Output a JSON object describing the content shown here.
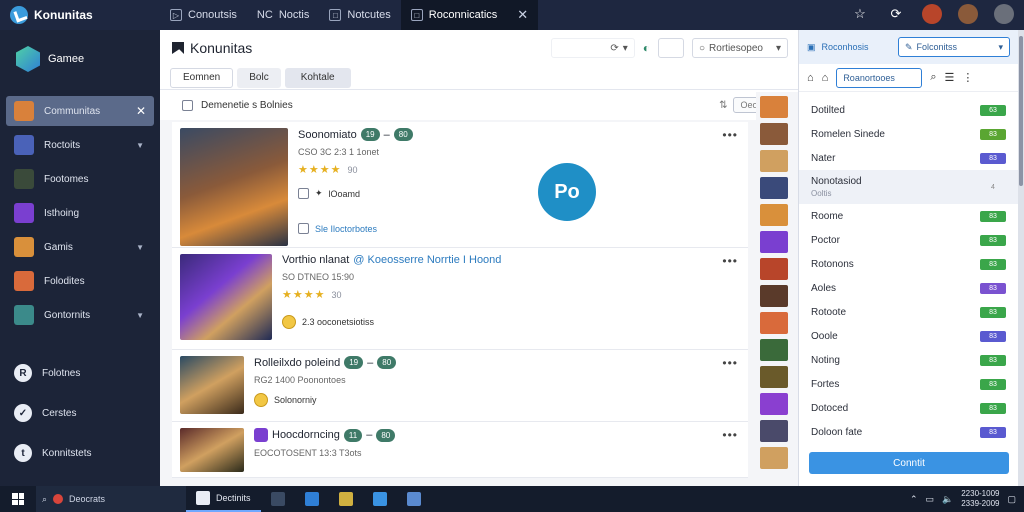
{
  "app": {
    "title": "Konunitas"
  },
  "tabs": [
    {
      "label": "Conoutsis",
      "icon": "play-icon"
    },
    {
      "label": "Noctis",
      "prefix": "NC"
    },
    {
      "label": "Notcutes",
      "icon": "window-icon"
    },
    {
      "label": "Roconnicatics",
      "icon": "window-icon",
      "active": true
    }
  ],
  "titlebar_icons": [
    "star-icon",
    "refresh-icon",
    "avatar-1",
    "avatar-2",
    "avatar-3"
  ],
  "sidebar": {
    "logo_label": "Gamee",
    "items": [
      {
        "label": "Communitas",
        "active": true,
        "color": "#d9813b"
      },
      {
        "label": "Roctoits",
        "chevron": true,
        "color": "#4a62b8"
      },
      {
        "label": "Footomes",
        "color": "#3a4a3a"
      },
      {
        "label": "Isthoing",
        "color": "#7a3fd0"
      },
      {
        "label": "Gamis",
        "chevron": true,
        "color": "#d9903b"
      },
      {
        "label": "Folodites",
        "color": "#d96a3b"
      },
      {
        "label": "Gontornits",
        "chevron": true,
        "color": "#3b8a8a"
      }
    ],
    "lower_items": [
      {
        "label": "Folotnes"
      },
      {
        "label": "Cerstes"
      },
      {
        "label": "Konnitstets"
      }
    ]
  },
  "main": {
    "title": "Konunitas",
    "header_search": "",
    "header_pin_label": "",
    "header_select": "Rortiesopeo",
    "subtabs": [
      "Eomnen",
      "Bolc",
      "Kohtale"
    ],
    "filter_label": "Demenetie s Bolnies",
    "filter_right_label": "Oeonis",
    "thumbs_header": "",
    "center_badge": "Po",
    "cards": [
      {
        "title": "Soonomiato",
        "badges": [
          "19",
          "80"
        ],
        "meta": "CSO  3C  2:3 1 1onet",
        "stars": "★★★★",
        "rating_note": "90",
        "line1": "lOoamd",
        "line2": "Sle Iloctorbotes"
      },
      {
        "title": "Vorthio nlanat",
        "link": "Koeosserre Norrtie I Hoond",
        "meta": "SO  DTNEO  15:90",
        "stars": "★★★★",
        "rating_note": "30",
        "line1": "2.3 ooconetsiotiss"
      },
      {
        "title": "Rolleilxdo poleind",
        "badges": [
          "19",
          "80"
        ],
        "meta": "RG2 1400 Poonontoes",
        "line1": "Solonorniy"
      },
      {
        "title": "Hoocdorncing",
        "badges": [
          "11",
          "80"
        ],
        "meta": "EOCOTOSENT  13:3  T3ots"
      }
    ]
  },
  "rpanel": {
    "header_label": "Roconhosis",
    "select_label": "Folconitss",
    "search_value": "Roanortooes",
    "rows": [
      {
        "label": "Dotilted",
        "tag": "63",
        "color": "#3aa64a"
      },
      {
        "label": "Romelen Sinede",
        "tag": "83",
        "color": "#5aa632"
      },
      {
        "label": "Nater",
        "tag": "83",
        "color": "#5a5ad0"
      },
      {
        "label": "Nonotasiod",
        "sub": "Ooltis",
        "tag": "4",
        "selected": true
      },
      {
        "label": "Roome",
        "tag": "83",
        "color": "#3aa64a"
      },
      {
        "label": "Poctor",
        "tag": "83",
        "color": "#3aa64a"
      },
      {
        "label": "Rotonons",
        "tag": "83",
        "color": "#3aa64a"
      },
      {
        "label": "Aoles",
        "tag": "83",
        "color": "#7a52d0"
      },
      {
        "label": "Rotoote",
        "tag": "83",
        "color": "#3aa64a"
      },
      {
        "label": "Ooole",
        "tag": "83",
        "color": "#5a5ad0"
      },
      {
        "label": "Noting",
        "tag": "83",
        "color": "#3aa64a"
      },
      {
        "label": "Fortes",
        "tag": "83",
        "color": "#3aa64a"
      },
      {
        "label": "Dotoced",
        "tag": "83",
        "color": "#3aa64a"
      },
      {
        "label": "Doloon fate",
        "tag": "83",
        "color": "#5a5ad0"
      }
    ],
    "cta": "Conntit"
  },
  "taskbar": {
    "search_label": "Deocrats",
    "apps": [
      {
        "label": "Dectinits",
        "open": true
      },
      {
        "label": "",
        "icon": "app-icon"
      }
    ],
    "clock_time": "2230-1009",
    "clock_date": "2339-2009"
  }
}
